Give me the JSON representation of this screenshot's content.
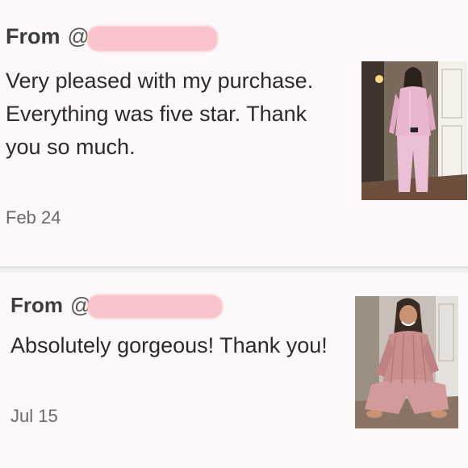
{
  "reviews": [
    {
      "from_label": "From",
      "at_symbol": "@",
      "text": "Very pleased with my purchase. Everything was five star. Thank you so much.",
      "date": "Feb 24",
      "photo_icon": "pajama-photo-standing",
      "colors": {
        "pajama": "#e8b6cf",
        "background": "#5e5148"
      }
    },
    {
      "from_label": "From",
      "at_symbol": "@",
      "text": "Absolutely gorgeous! Thank you!",
      "date": "Jul 15",
      "photo_icon": "pajama-photo-sitting",
      "colors": {
        "pajama": "#c98e8e",
        "background": "#c8c0b8"
      }
    }
  ],
  "colors": {
    "redaction": "#f9c4cc",
    "page_background": "#fdf8f9"
  }
}
